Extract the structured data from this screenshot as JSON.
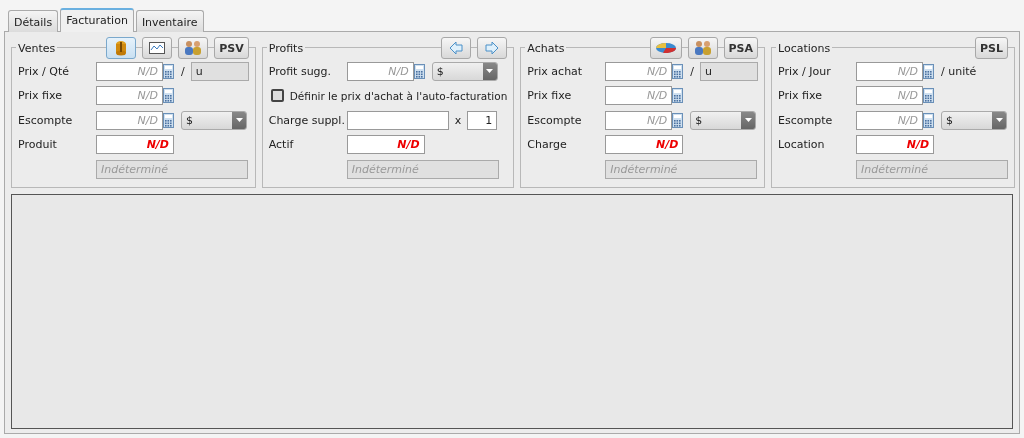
{
  "tabs": [
    {
      "label": "Détails",
      "selected": false
    },
    {
      "label": "Facturation",
      "selected": true
    },
    {
      "label": "Inventaire",
      "selected": false
    }
  ],
  "panels": [
    {
      "title": "Ventes",
      "buttons": [
        {
          "kind": "coin",
          "selected": true
        },
        {
          "kind": "chart",
          "selected": false
        },
        {
          "kind": "people",
          "selected": false
        },
        {
          "kind": "text",
          "label": "PSV",
          "selected": false
        }
      ],
      "rows": [
        {
          "kind": "amount",
          "label": "Prix / Qté",
          "placeholder": "N/D",
          "unit_sep": "/",
          "unit": "u"
        },
        {
          "kind": "amount",
          "label": "Prix fixe",
          "placeholder": "N/D"
        },
        {
          "kind": "amount",
          "label": "Escompte",
          "placeholder": "N/D",
          "currency": "$"
        },
        {
          "kind": "total",
          "label": "Produit",
          "value": "N/D"
        },
        {
          "kind": "note",
          "placeholder": "Indéterminé"
        }
      ]
    },
    {
      "title": "Profits",
      "buttons": [
        {
          "kind": "arrow-left",
          "selected": false
        },
        {
          "kind": "arrow-right",
          "selected": false
        }
      ],
      "rows": [
        {
          "kind": "amount",
          "label": "Profit sugg.",
          "placeholder": "N/D",
          "currency": "$"
        },
        {
          "kind": "checkbox",
          "label": "Définir le prix d'achat à l'auto-facturation",
          "checked": false
        },
        {
          "kind": "multiplier",
          "label": "Charge suppl.",
          "sep": "x",
          "value": "1"
        },
        {
          "kind": "total",
          "label": "Actif",
          "value": "N/D"
        },
        {
          "kind": "note",
          "placeholder": "Indéterminé"
        }
      ]
    },
    {
      "title": "Achats",
      "buttons": [
        {
          "kind": "pie",
          "selected": false
        },
        {
          "kind": "people",
          "selected": false
        },
        {
          "kind": "text",
          "label": "PSA",
          "selected": false
        }
      ],
      "rows": [
        {
          "kind": "amount",
          "label": "Prix achat",
          "placeholder": "N/D",
          "unit_sep": "/",
          "unit": "u"
        },
        {
          "kind": "amount",
          "label": "Prix fixe",
          "placeholder": "N/D"
        },
        {
          "kind": "amount",
          "label": "Escompte",
          "placeholder": "N/D",
          "currency": "$"
        },
        {
          "kind": "total",
          "label": "Charge",
          "value": "N/D"
        },
        {
          "kind": "note",
          "placeholder": "Indéterminé"
        }
      ]
    },
    {
      "title": "Locations",
      "buttons": [
        {
          "kind": "text",
          "label": "PSL",
          "selected": false
        }
      ],
      "rows": [
        {
          "kind": "amount",
          "label": "Prix / Jour",
          "placeholder": "N/D",
          "suffix": "/ unité"
        },
        {
          "kind": "amount",
          "label": "Prix fixe",
          "placeholder": "N/D"
        },
        {
          "kind": "amount",
          "label": "Escompte",
          "placeholder": "N/D",
          "currency": "$"
        },
        {
          "kind": "total",
          "label": "Location",
          "value": "N/D"
        },
        {
          "kind": "note",
          "placeholder": "Indéterminé"
        }
      ]
    }
  ]
}
